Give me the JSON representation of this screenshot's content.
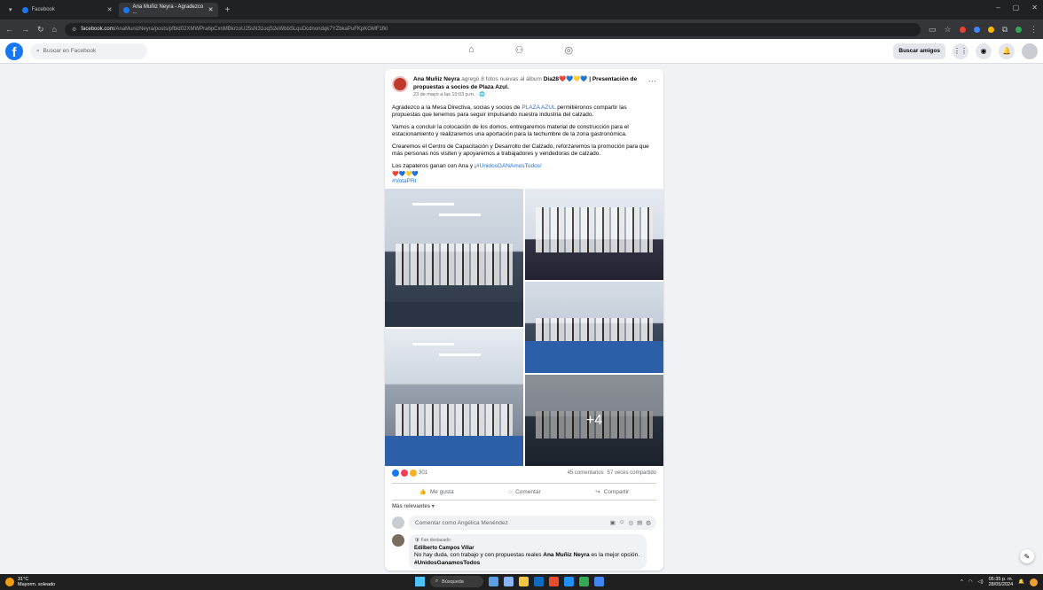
{
  "browser": {
    "tabs": [
      {
        "label": "Facebook",
        "active": false
      },
      {
        "label": "Ana Muñiz Neyra - Agradezco ...",
        "active": true
      }
    ],
    "url_host": "facebook.com",
    "url_path": "/AnaMunizNeyra/posts/pfbid02XMWPra6pCxnMBkrzoU25sN31oqS2eWbbSLquDcdnondqk7YZbkaPuFKpKGMF1fkl",
    "new_tab": "+",
    "window_controls": [
      "–",
      "▢",
      "✕"
    ]
  },
  "fb_header": {
    "search_placeholder": "Buscar en Facebook",
    "find_friends": "Buscar amigos"
  },
  "post": {
    "author": "Ana Muñiz Neyra",
    "action": "agregó 8 fotos nuevas al álbum",
    "album": "Día28❤️💙💛💙 | Presentación de propuestas a socios de Plaza Azul.",
    "date": "23 de mayo a las 10:03 p.m. · 🌐",
    "p1_a": "Agradezco a la Mesa Directiva, socias y socios de ",
    "p1_link": "PLAZA AZUL",
    "p1_b": " permitiéronos compartir las propuestas que tenemos para seguir impulsando nuestra industria del calzado.",
    "p2": "Vamos a concluir la colocación de los domos, entregaremos material de construcción para el estacionamiento y realizaremos una aportación para la techumbre de la zona gastronómica.",
    "p3": "Crearemos el Centro de Capacitación y Desarrollo del Calzado, reforzaremos la promoción para que más personas nos visiten y apoyaremos a trabajadores y vendedoras de calzado.",
    "p4_a": "Los zapateros ganan con Ana y ¡",
    "p4_link": "#UnidosGANAmosTodos!",
    "hearts": "❤️💙💛💙",
    "hashtag": "#VotaPRI",
    "extra_photos": "+4",
    "reaction_count": "301",
    "comments": "45 comentarios",
    "shares": "57 veces compartido",
    "like": "Me gusta",
    "comment": "Comentar",
    "share": "Compartir",
    "sort": "Más relevantes ▾",
    "comment_placeholder": "Comentar como Angélica Menéndez",
    "top_comment": {
      "badge": "🛡 Fan destacado",
      "author": "Edilberto Campos Villar",
      "text_a": "No hay duda, con trabajo y con propuestas reales ",
      "text_bold": "Ana Muñiz Neyra",
      "text_b": " es la mejor opción. ",
      "tag": "#UnidosGanamosTodos"
    }
  },
  "taskbar": {
    "temp": "31°C",
    "weather": "Mayorm. soleado",
    "search": "Búsqueda",
    "time": "05:35 p. m.",
    "date": "28/05/2024"
  },
  "colors": {
    "facebook_blue": "#1877f2",
    "link": "#216fdb"
  }
}
